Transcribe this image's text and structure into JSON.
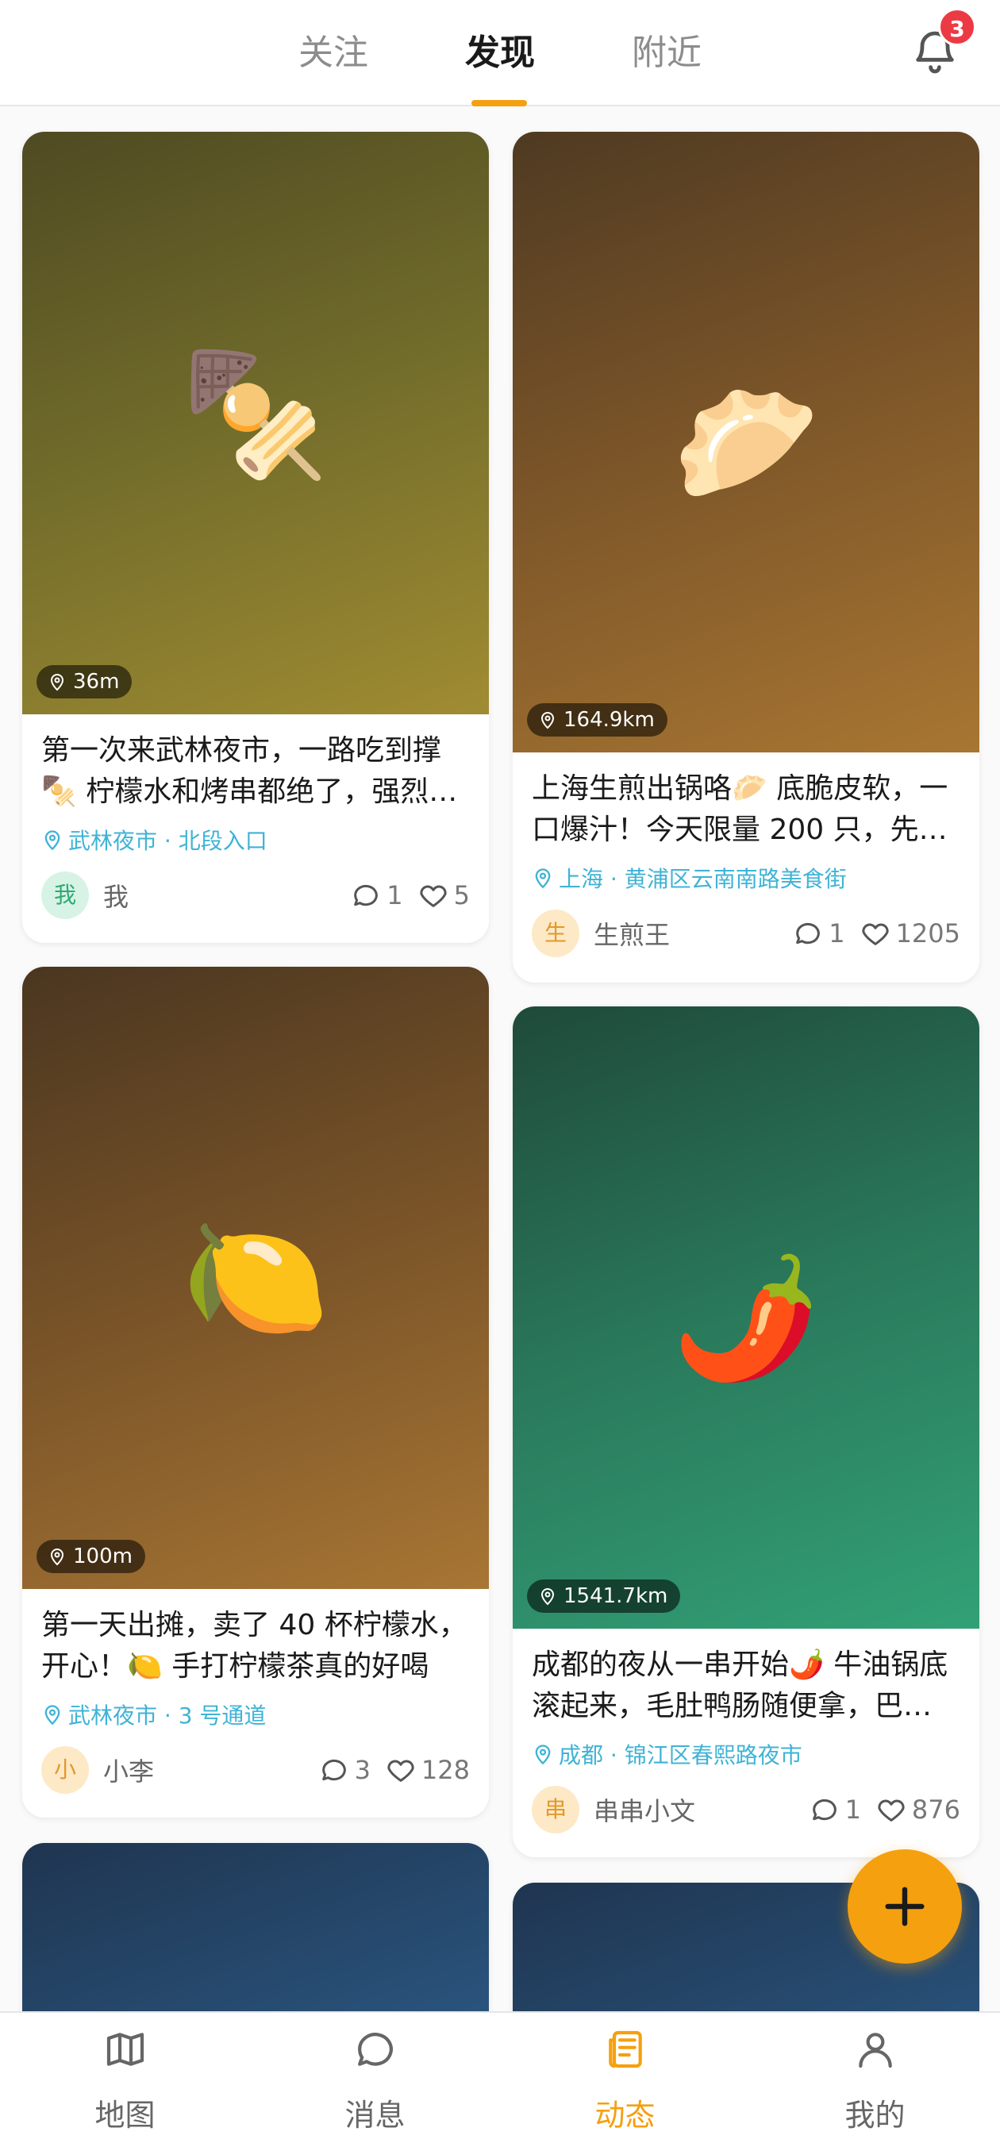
{
  "header": {
    "tabs": [
      {
        "label": "关注",
        "active": false
      },
      {
        "label": "发现",
        "active": true
      },
      {
        "label": "附近",
        "active": false
      }
    ],
    "notification_count": "3",
    "icons": {
      "bell": "bell-icon"
    }
  },
  "colors": {
    "accent": "#f5a00f",
    "location": "#3fb3d6",
    "badge": "#ec3a44"
  },
  "posts": [
    {
      "distance": "36m",
      "emoji": "🍢",
      "title": "第一次来武林夜市，一路吃到撑🍢 柠檬水和烤串都绝了，强烈推荐",
      "location": "武林夜市 · 北段入口",
      "avatar": "我",
      "author": "我",
      "comments": "1",
      "likes": "5"
    },
    {
      "distance": "164.9km",
      "emoji": "🥟",
      "title": "上海生煎出锅咯🥟 底脆皮软，一口爆汁！今天限量 200 只，先到先得",
      "location": "上海 · 黄浦区云南南路美食街",
      "avatar": "生",
      "author": "生煎王",
      "comments": "1",
      "likes": "1205"
    },
    {
      "distance": "100m",
      "emoji": "🍋",
      "title": "第一天出摊，卖了 40 杯柠檬水，开心！🍋 手打柠檬茶真的好喝",
      "location": "武林夜市 · 3 号通道",
      "avatar": "小",
      "author": "小李",
      "comments": "3",
      "likes": "128"
    },
    {
      "distance": "1541.7km",
      "emoji": "🌶️",
      "title": "成都的夜从一串开始🌶️ 牛油锅底滚起来，毛肚鸭肠随便拿，巴适得很",
      "location": "成都 · 锦江区春熙路夜市",
      "avatar": "串",
      "author": "串串小文",
      "comments": "1",
      "likes": "876"
    }
  ],
  "bottom_nav": [
    {
      "label": "地图",
      "icon": "map-icon",
      "active": false
    },
    {
      "label": "消息",
      "icon": "message-icon",
      "active": false
    },
    {
      "label": "动态",
      "icon": "feed-icon",
      "active": true
    },
    {
      "label": "我的",
      "icon": "profile-icon",
      "active": false
    }
  ],
  "fab": {
    "icon": "plus-icon"
  }
}
